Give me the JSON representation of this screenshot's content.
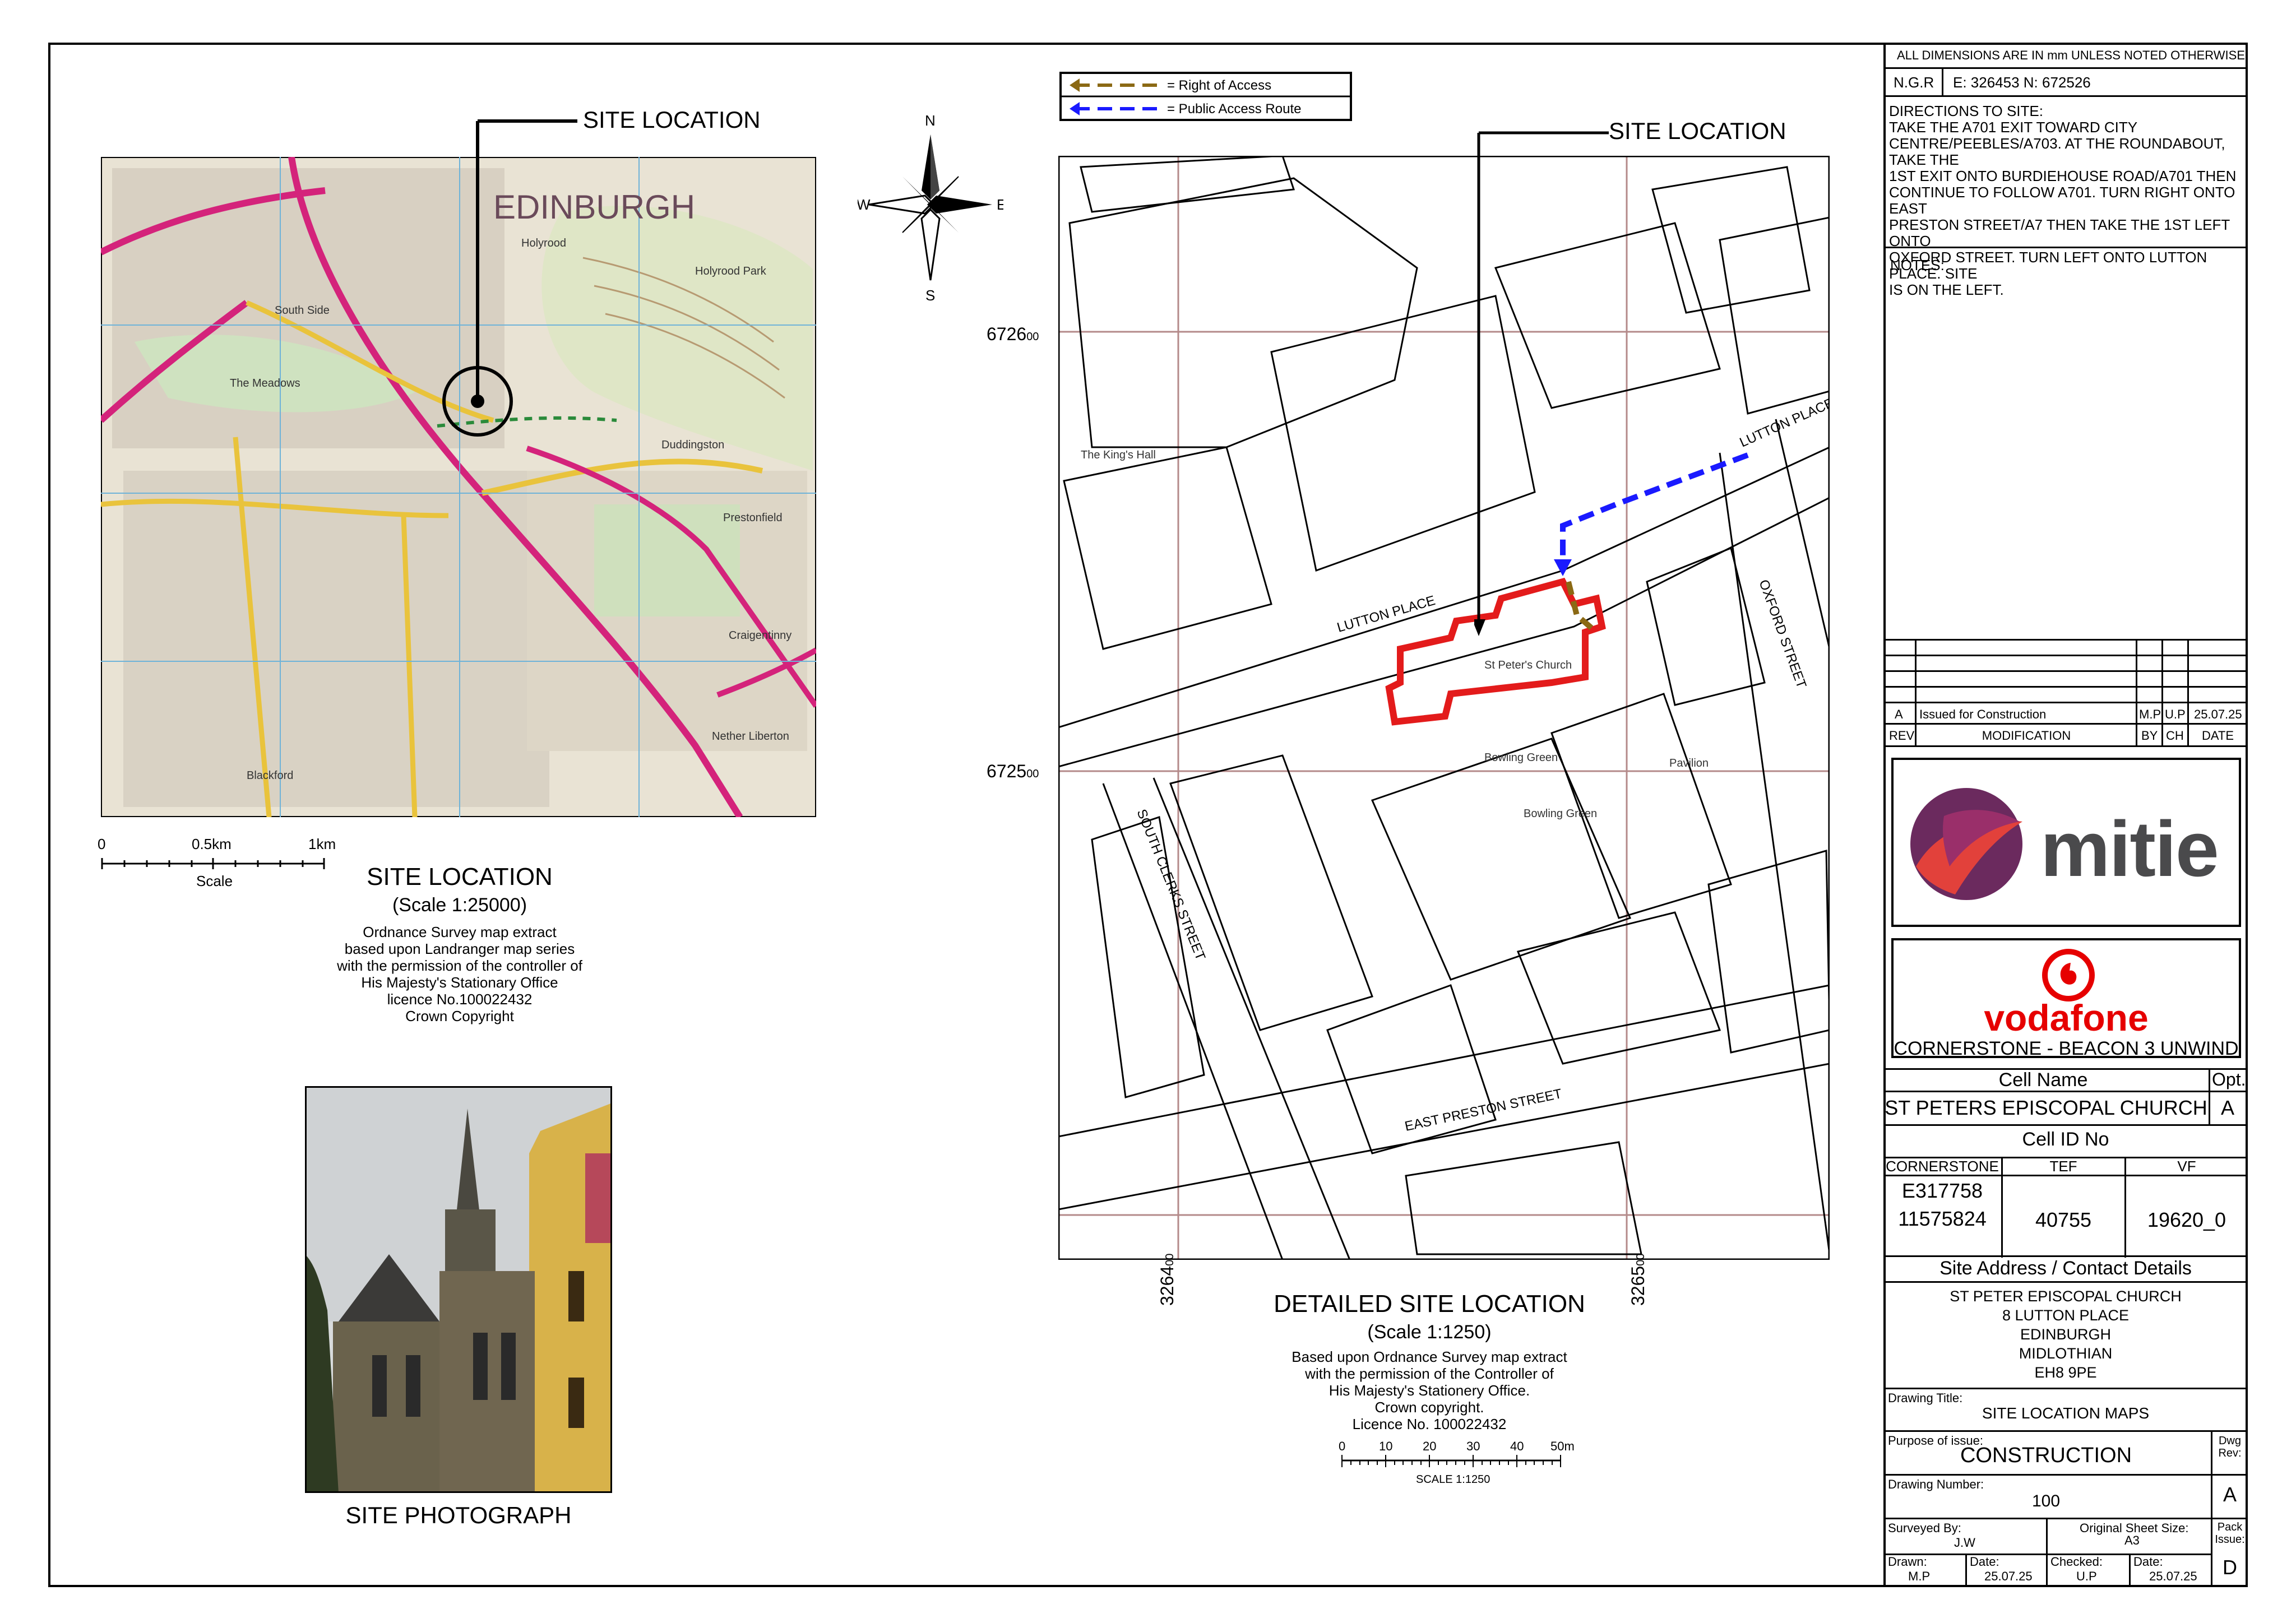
{
  "overview": {
    "site_location_callout": "SITE LOCATION",
    "map_city_label": "EDINBURGH",
    "map_labels": [
      "Holyrood",
      "Holyrood Park",
      "The Meadows",
      "South Side",
      "Blackford",
      "Nether Liberton",
      "Prestonfield",
      "Craigentinny",
      "Duddingston"
    ],
    "scale_bar": {
      "labels": [
        "0",
        "0.5km",
        "1km"
      ],
      "caption": "Scale"
    },
    "title": "SITE LOCATION",
    "scale": "(Scale 1:25000)",
    "notes": [
      "Ordnance Survey map extract",
      "based upon Landranger map series",
      "with the permission of the controller of",
      "His Majesty's Stationary Office",
      "licence No.100022432",
      "Crown Copyright"
    ]
  },
  "compass": {
    "n": "N",
    "s": "S",
    "e": "E",
    "w": "W"
  },
  "photo": {
    "caption": "SITE PHOTOGRAPH"
  },
  "detail": {
    "site_location_callout": "SITE LOCATION",
    "legend": [
      {
        "label": "= Right of Access",
        "color": "#8B6914"
      },
      {
        "label": "= Public Access Route",
        "color": "#1a1aff"
      }
    ],
    "northings": [
      "6726",
      "6725"
    ],
    "northing_suffix": "00",
    "eastings": [
      "3264",
      "3265"
    ],
    "easting_suffix": "00",
    "streets": [
      "LUTTON PLACE",
      "LUTTON PLACE",
      "OXFORD STREET",
      "SOUTH CLERKS STREET",
      "EAST PRESTON STREET"
    ],
    "buildings": [
      "St Peter's Church",
      "Bowling Green",
      "Bowling Green",
      "The King's Hall",
      "Pavilion"
    ],
    "title": "DETAILED SITE LOCATION",
    "scale": "(Scale 1:1250)",
    "notes": [
      "Based upon Ordnance Survey map extract",
      "with the permission of the Controller of",
      "His Majesty's Stationery Office.",
      "Crown copyright.",
      "Licence No. 100022432"
    ],
    "scale_bar": {
      "labels": [
        "0",
        "10",
        "20",
        "30",
        "40",
        "50m"
      ],
      "caption": "SCALE 1:1250"
    }
  },
  "title_block": {
    "dims_note": "ALL DIMENSIONS ARE IN mm UNLESS NOTED OTHERWISE",
    "ngr_label": "N.G.R",
    "ngr_value": "E: 326453   N: 672526",
    "directions": [
      "DIRECTIONS TO SITE:",
      "TAKE THE A701 EXIT TOWARD CITY",
      "CENTRE/PEEBLES/A703. AT THE ROUNDABOUT, TAKE THE",
      "1ST EXIT ONTO BURDIEHOUSE ROAD/A701 THEN",
      "CONTINUE TO FOLLOW A701. TURN RIGHT ONTO EAST",
      "PRESTON STREET/A7 THEN TAKE THE 1ST LEFT ONTO",
      "OXFORD STREET. TURN LEFT ONTO LUTTON PLACE. SITE",
      "IS ON THE LEFT."
    ],
    "notes_label": "NOTES:",
    "revision": {
      "rev": "A",
      "modification": "Issued for Construction",
      "by": "M.P",
      "ch": "U.P",
      "date": "25.07.25"
    },
    "rev_headers": {
      "rev": "REV",
      "modification": "MODIFICATION",
      "by": "BY",
      "ch": "CH",
      "date": "DATE"
    },
    "mitie_text": "mitie",
    "vodafone_text": "vodafone",
    "project": "CORNERSTONE - BEACON 3 UNWIND",
    "cell_name_label": "Cell Name",
    "opt_label": "Opt.",
    "cell_name": "ST PETERS EPISCOPAL CHURCH",
    "opt": "A",
    "cell_id_label": "Cell ID No",
    "id_headers": [
      "CORNERSTONE",
      "TEF",
      "VF"
    ],
    "cornerstone_ids": [
      "E317758",
      "11575824"
    ],
    "tef_id": "40755",
    "vf_id": "19620_0",
    "address_label": "Site Address / Contact Details",
    "address": [
      "ST PETER EPISCOPAL CHURCH",
      "8 LUTTON PLACE",
      "EDINBURGH",
      "MIDLOTHIAN",
      "EH8 9PE"
    ],
    "drawing_title_label": "Drawing Title:",
    "drawing_title": "SITE LOCATION MAPS",
    "purpose_label": "Purpose of issue:",
    "purpose": "CONSTRUCTION",
    "dwg_rev_label": "Dwg Rev:",
    "dwg_rev": "A",
    "drawing_number_label": "Drawing Number:",
    "drawing_number": "100",
    "surveyed_label": "Surveyed By:",
    "surveyed": "J.W",
    "sheet_size_label": "Original Sheet Size:",
    "sheet_size": "A3",
    "pack_issue_label": "Pack Issue:",
    "pack_issue": "D",
    "drawn_label": "Drawn:",
    "drawn": "M.P",
    "date1_label": "Date:",
    "date1": "25.07.25",
    "checked_label": "Checked:",
    "checked": "U.P",
    "date2_label": "Date:",
    "date2": "25.07.25"
  }
}
